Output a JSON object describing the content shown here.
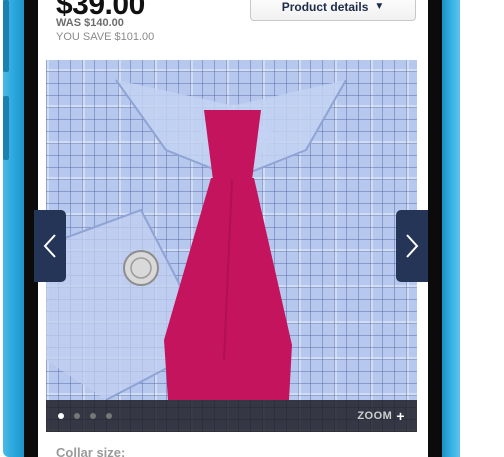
{
  "product": {
    "price_now": "$39.00",
    "price_was": "WAS $140.00",
    "savings": "YOU SAVE $101.00"
  },
  "header": {
    "details_label": "Product details",
    "details_icon": "triangle-down-icon"
  },
  "gallery": {
    "image_description_icon": "shirt-and-tie-photo",
    "slide_count": 4,
    "active_slide": 1,
    "zoom_label": "ZOOM",
    "zoom_icon": "plus-icon",
    "prev_icon": "chevron-left-icon",
    "next_icon": "chevron-right-icon"
  },
  "options": {
    "collar_label": "Collar size:"
  },
  "colors": {
    "phone_frame": "#2aa7dd",
    "nav_arrow": "#243558",
    "tie": "#c4145e",
    "fabric": "#b7c8ee"
  }
}
